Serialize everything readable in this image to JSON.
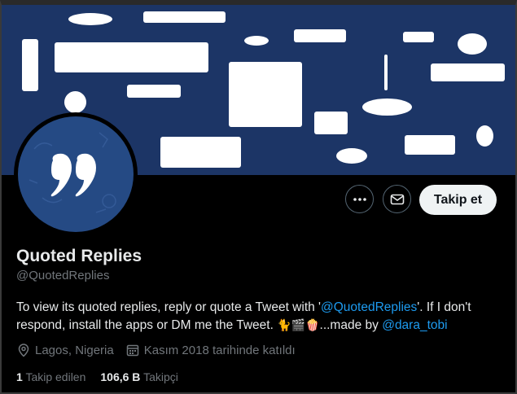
{
  "profile": {
    "display_name": "Quoted Replies",
    "handle": "@QuotedReplies",
    "follow_label": "Takip et",
    "bio": {
      "part1": "To view its quoted replies, reply or quote a Tweet with '",
      "mention1": "@QuotedReplies",
      "part2": "'. If I don't respond, install the apps or DM me the Tweet. ",
      "emojis": "🐈🎬🍿",
      "part3": "...made by ",
      "mention2": "@dara_tobi"
    },
    "location": "Lagos, Nigeria",
    "joined": "Kasım 2018 tarihinde katıldı",
    "following_count": "1",
    "following_label": "Takip edilen",
    "followers_count": "106,6 B",
    "followers_label": "Takipçi"
  },
  "icons": {
    "more": "more-icon",
    "message": "envelope-icon",
    "location": "location-pin-icon",
    "calendar": "calendar-icon",
    "avatar_glyph": "quote-mark-icon"
  },
  "colors": {
    "banner": "#1c3566",
    "avatar": "#254a84",
    "link": "#1d9bf0",
    "muted": "#71767b",
    "text": "#e7e9ea",
    "follow_button_bg": "#eff3f4"
  }
}
